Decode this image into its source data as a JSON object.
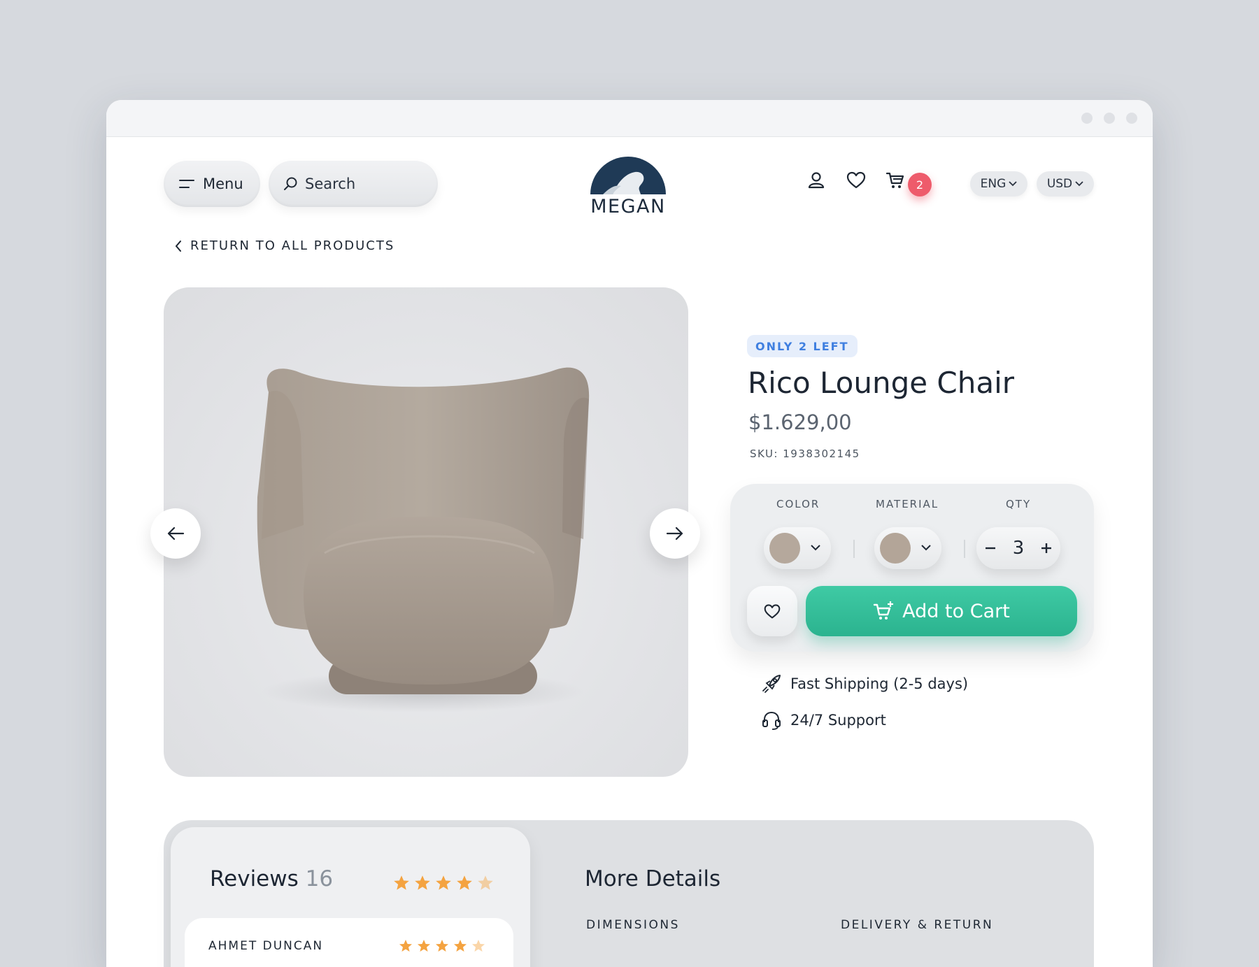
{
  "header": {
    "menu_label": "Menu",
    "search_label": "Search",
    "brand": "MEGAN",
    "cart_count": "2",
    "language": "ENG",
    "currency": "USD"
  },
  "breadcrumb": {
    "back_label": "RETURN TO ALL PRODUCTS"
  },
  "product": {
    "stock_badge": "ONLY 2 LEFT",
    "title": "Rico Lounge Chair",
    "price": "$1.629,00",
    "sku": "SKU: 1938302145"
  },
  "options": {
    "color_label": "COLOR",
    "material_label": "MATERIAL",
    "qty_label": "QTY",
    "qty_value": "3",
    "color_swatch": "#b5a89c",
    "material_swatch": "#b3a598"
  },
  "actions": {
    "add_to_cart": "Add to Cart"
  },
  "features": [
    {
      "icon": "rocket-icon",
      "label": "Fast Shipping (2-5 days)"
    },
    {
      "icon": "headset-icon",
      "label": "24/7 Support"
    }
  ],
  "reviews": {
    "title": "Reviews",
    "count": "16",
    "rating": 4.5,
    "items": [
      {
        "name": "AHMET DUNCAN",
        "rating": 4.5
      }
    ]
  },
  "details": {
    "title": "More Details",
    "headings": [
      "DIMENSIONS",
      "DELIVERY & RETURN"
    ]
  },
  "colors": {
    "accent": "#2bb38f",
    "badge": "#ee5b6b",
    "stock_badge_text": "#3f7fe0",
    "star": "#f4a340"
  }
}
